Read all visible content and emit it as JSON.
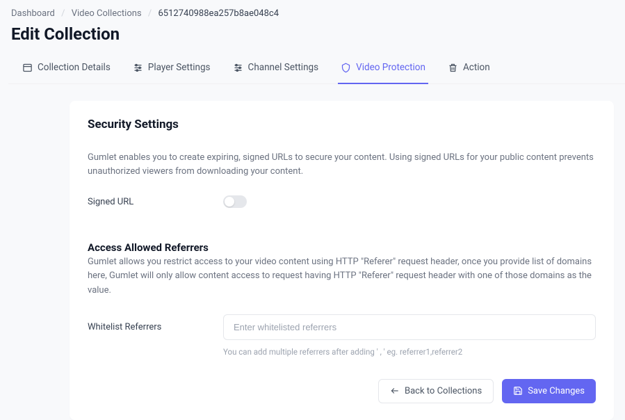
{
  "breadcrumb": {
    "items": [
      "Dashboard",
      "Video Collections"
    ],
    "current": "6512740988ea257b8ae048c4"
  },
  "page_title": "Edit Collection",
  "tabs": [
    {
      "label": "Collection Details"
    },
    {
      "label": "Player Settings"
    },
    {
      "label": "Channel Settings"
    },
    {
      "label": "Video Protection"
    },
    {
      "label": "Action"
    }
  ],
  "active_tab_index": 3,
  "security": {
    "title": "Security Settings",
    "desc": "Gumlet enables you to create expiring, signed URLs to secure your content. Using signed URLs for your public content prevents unauthorized viewers from downloading your content.",
    "signed_url_label": "Signed URL",
    "signed_url_enabled": false
  },
  "referrers": {
    "title": "Access Allowed Referrers",
    "desc": "Gumlet allows you restrict access to your video content using HTTP \"Referer\" request header, once you provide list of domains here, Gumlet will only allow content access to request having HTTP \"Referer\" request header with one of those domains as the value.",
    "label": "Whitelist Referrers",
    "placeholder": "Enter whitelisted referrers",
    "helper": "You can add multiple referrers after adding ' , '   eg. referrer1,referrer2"
  },
  "actions": {
    "back_label": "Back to Collections",
    "save_label": "Save Changes"
  }
}
